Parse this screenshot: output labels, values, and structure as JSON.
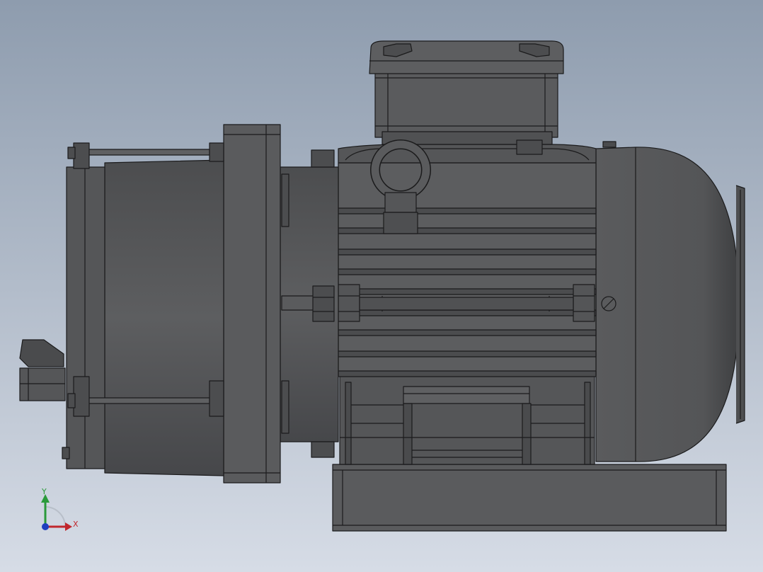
{
  "viewport": {
    "background_top": "#8e9cae",
    "background_bottom": "#d6dce6"
  },
  "model": {
    "body_color": "#5a5b5d",
    "dark_color": "#3f4042",
    "edge_color": "#1b1b1c",
    "highlight_color": "#707173"
  },
  "triad": {
    "x_label": "X",
    "y_label": "Y",
    "x_color": "#c0272d",
    "y_color": "#2a9a3a",
    "z_color": "#1f3fbf"
  }
}
